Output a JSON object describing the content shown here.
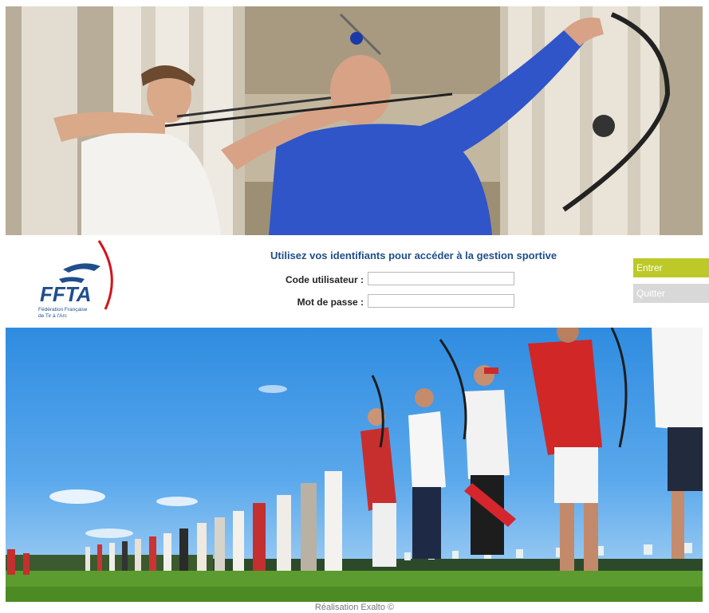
{
  "login": {
    "title": "Utilisez vos identifiants pour accéder à la gestion sportive",
    "user_label": "Code utilisateur :",
    "user_value": "",
    "password_label": "Mot de passe :",
    "password_value": "",
    "enter_label": "Entrer",
    "quit_label": "Quitter"
  },
  "logo": {
    "brand": "FFTA",
    "caption_line1": "Fédération Française",
    "caption_line2": "de Tir à l'Arc"
  },
  "footer": {
    "credit": "Réalisation Exalto ©"
  },
  "colors": {
    "title_blue": "#1f4e8c",
    "enter_green": "#bcc928",
    "quit_grey": "#d8d8d8",
    "logo_red": "#d1141c"
  }
}
